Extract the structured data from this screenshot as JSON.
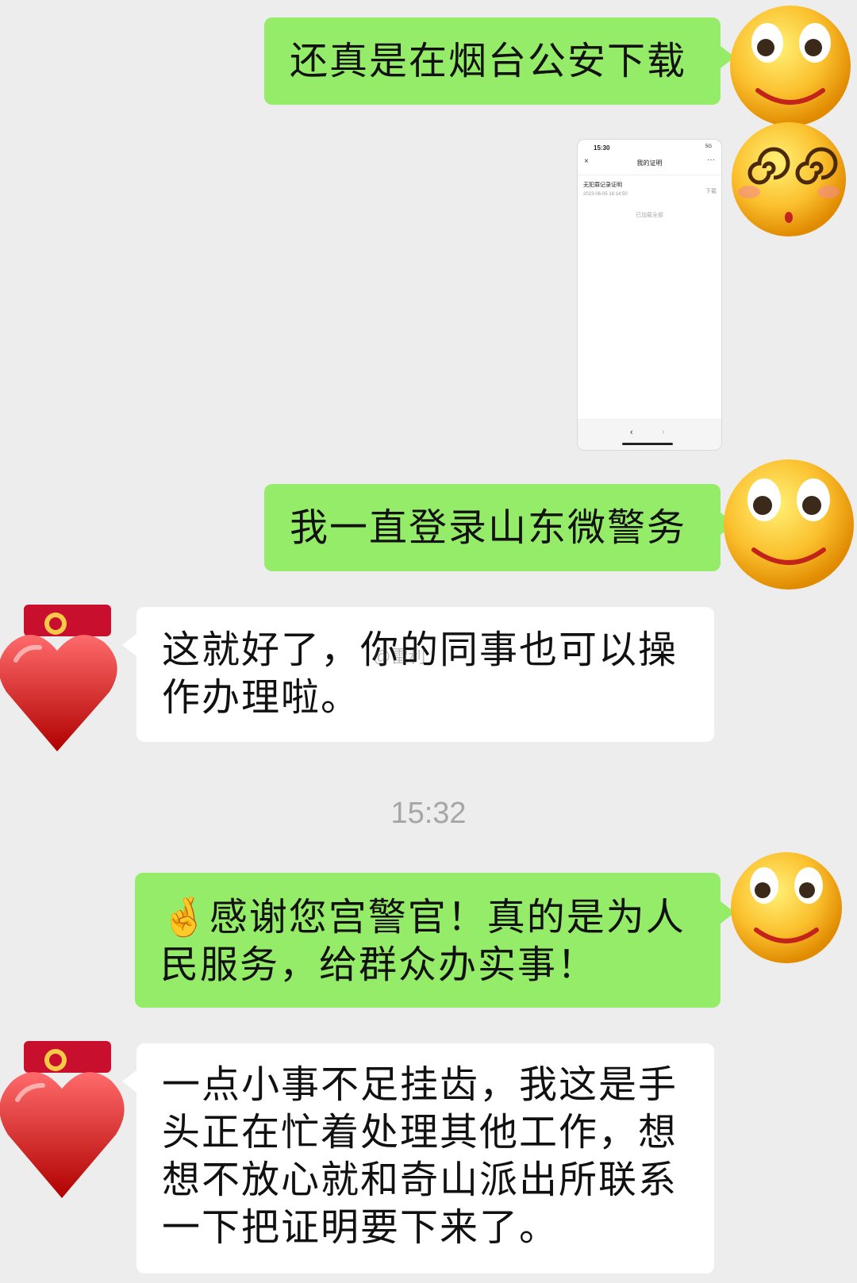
{
  "colors": {
    "sent_bubble": "#95ec69",
    "received_bubble": "#ffffff",
    "background": "#ededed"
  },
  "messages": [
    {
      "text": "还真是在烟台公安下载",
      "avatar": "smiley-avatar"
    },
    {
      "image": "screenshot-image",
      "avatar": "dizzy-face-avatar"
    },
    {
      "text": "我一直登录山东微警务",
      "avatar": "smiley-avatar"
    },
    {
      "text": "这就好了，你的同事也可以操作办理啦。",
      "avatar": "heart-police-emblem-avatar"
    },
    {
      "text": "🤞感谢您宫警官！真的是为人民服务，给群众办实事！",
      "avatar": "smiley-avatar"
    },
    {
      "text": "一点小事不足挂齿，我这是手头正在忙着处理其他工作，想想不放心就和奇山派出所联系一下把证明要下来了。",
      "avatar": "heart-police-emblem-avatar"
    }
  ],
  "timestamp": "15:32",
  "screenshot": {
    "status_time": "15:30",
    "signal": "5G",
    "title": "我的证明",
    "close_icon": "×",
    "more_icon": "···",
    "cert_title": "无犯罪记录证明",
    "cert_date": "2023-06-05 16:14:50",
    "download": "下载",
    "loaded_all": "已加载全部",
    "back": "‹",
    "forward": "›"
  },
  "watermark": "@雷利"
}
